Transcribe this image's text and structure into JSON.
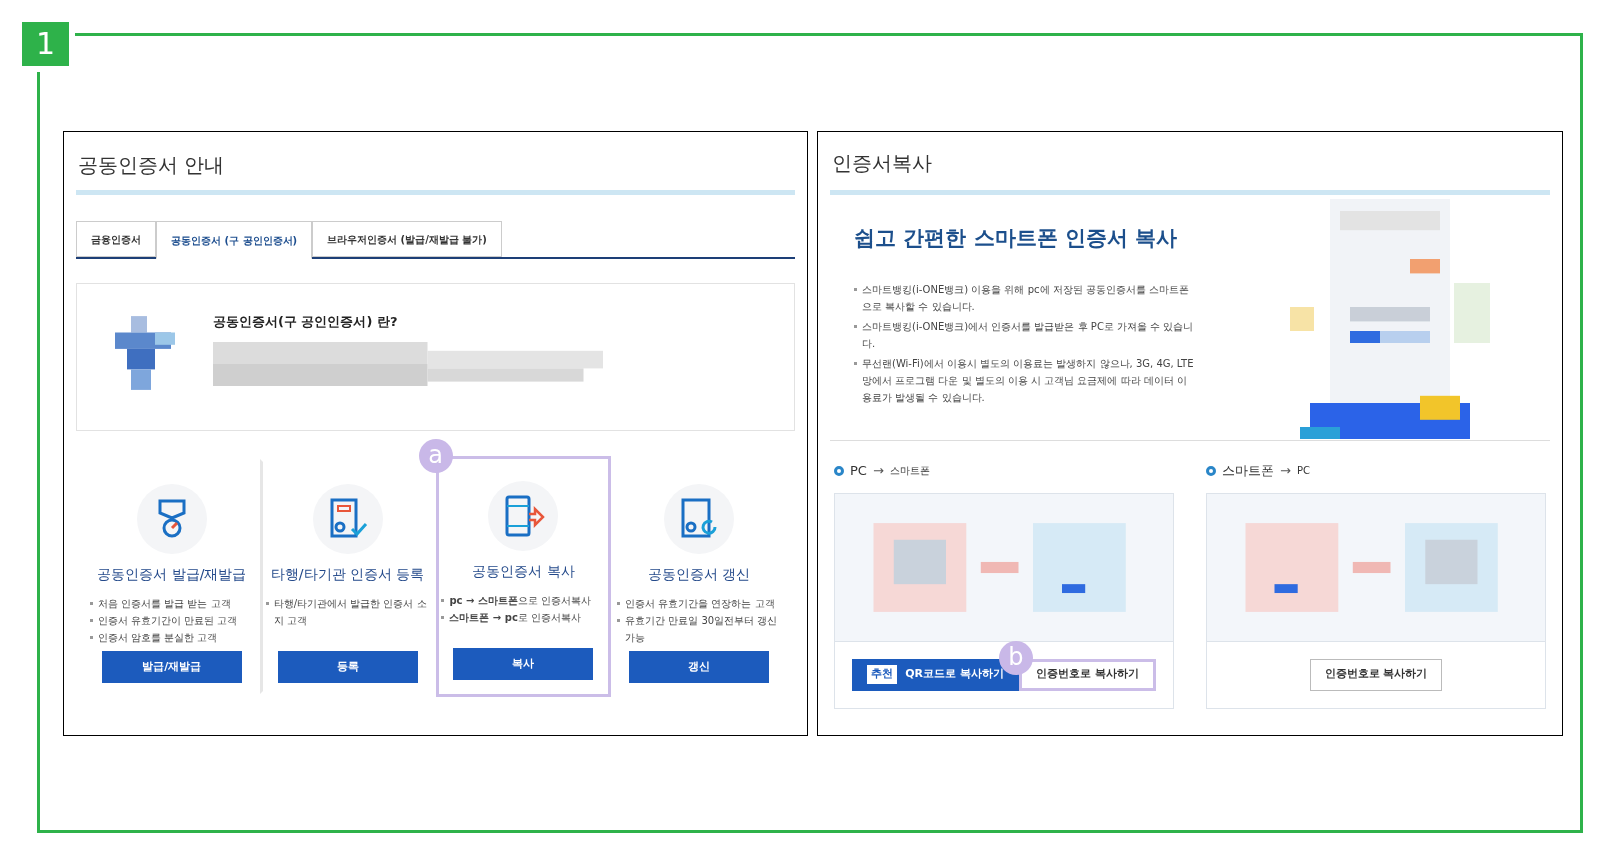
{
  "step_badge": "1",
  "left_panel": {
    "title": "공동인증서 안내",
    "tabs": [
      {
        "label": "금융인증서",
        "selected": false
      },
      {
        "label": "공동인증서 (구 공인인증서)",
        "selected": true
      },
      {
        "label": "브라우저인증서 (발급/재발급 불가)",
        "selected": false
      }
    ],
    "info_heading": "공동인증서(구 공인인증서) 란?",
    "services": [
      {
        "kind": "medal",
        "title": "공동인증서 발급/재발급",
        "bullets": [
          "처음 인증서를 발급 받는 고객",
          "인증서 유효기간이 만료된 고객",
          "인증서 암호를 분실한 고객"
        ],
        "button": "발급/재발급",
        "highlighted": false
      },
      {
        "kind": "register",
        "title": "타행/타기관 인증서 등록",
        "bullets": [
          "타행/타기관에서 발급한 인증서 소지 고객"
        ],
        "button": "등록",
        "highlighted": false
      },
      {
        "kind": "copy",
        "title": "공동인증서 복사",
        "bullets": [
          "**pc → 스마트폰**으로 인증서복사",
          "**스마트폰 → pc**로 인증서복사"
        ],
        "button": "복사",
        "highlighted": true,
        "marker": "a"
      },
      {
        "kind": "renew",
        "title": "공동인증서 갱신",
        "bullets": [
          "인증서 유효기간을 연장하는 고객",
          "유효기간 만료일 30일전부터 갱신가능"
        ],
        "button": "갱신",
        "highlighted": false
      }
    ]
  },
  "right_panel": {
    "title": "인증서복사",
    "headline": "쉽고 간편한 스마트폰 인증서 복사",
    "bullets": [
      "스마트뱅킹(i-ONE뱅크) 이용을 위해 pc에 저장된 공동인증서를 스마트폰으로 복사할 수 있습니다.",
      "스마트뱅킹(i-ONE뱅크)에서 인증서를 발급받은 후 PC로 가져올 수 있습니다.",
      "무선랜(Wi-Fi)에서 이용시 별도의 이용료는 발생하지 않으나, 3G, 4G, LTE망에서 프로그램 다운 및 별도의 이용 시 고객님 요금제에 따라 데이터 이용료가 발생될 수 있습니다."
    ],
    "sections": [
      {
        "from": "PC",
        "arrow": "→",
        "to": "스마트폰",
        "buttons": [
          {
            "kind": "primary",
            "badge": "추천",
            "label": "QR코드로 복사하기",
            "highlighted": false
          },
          {
            "kind": "outline",
            "label": "인증번호로 복사하기",
            "highlighted": true,
            "marker": "b"
          }
        ]
      },
      {
        "from": "스마트폰",
        "arrow": "→",
        "to": "PC",
        "buttons": [
          {
            "kind": "outline",
            "label": "인증번호로 복사하기",
            "highlighted": false
          }
        ]
      }
    ]
  }
}
